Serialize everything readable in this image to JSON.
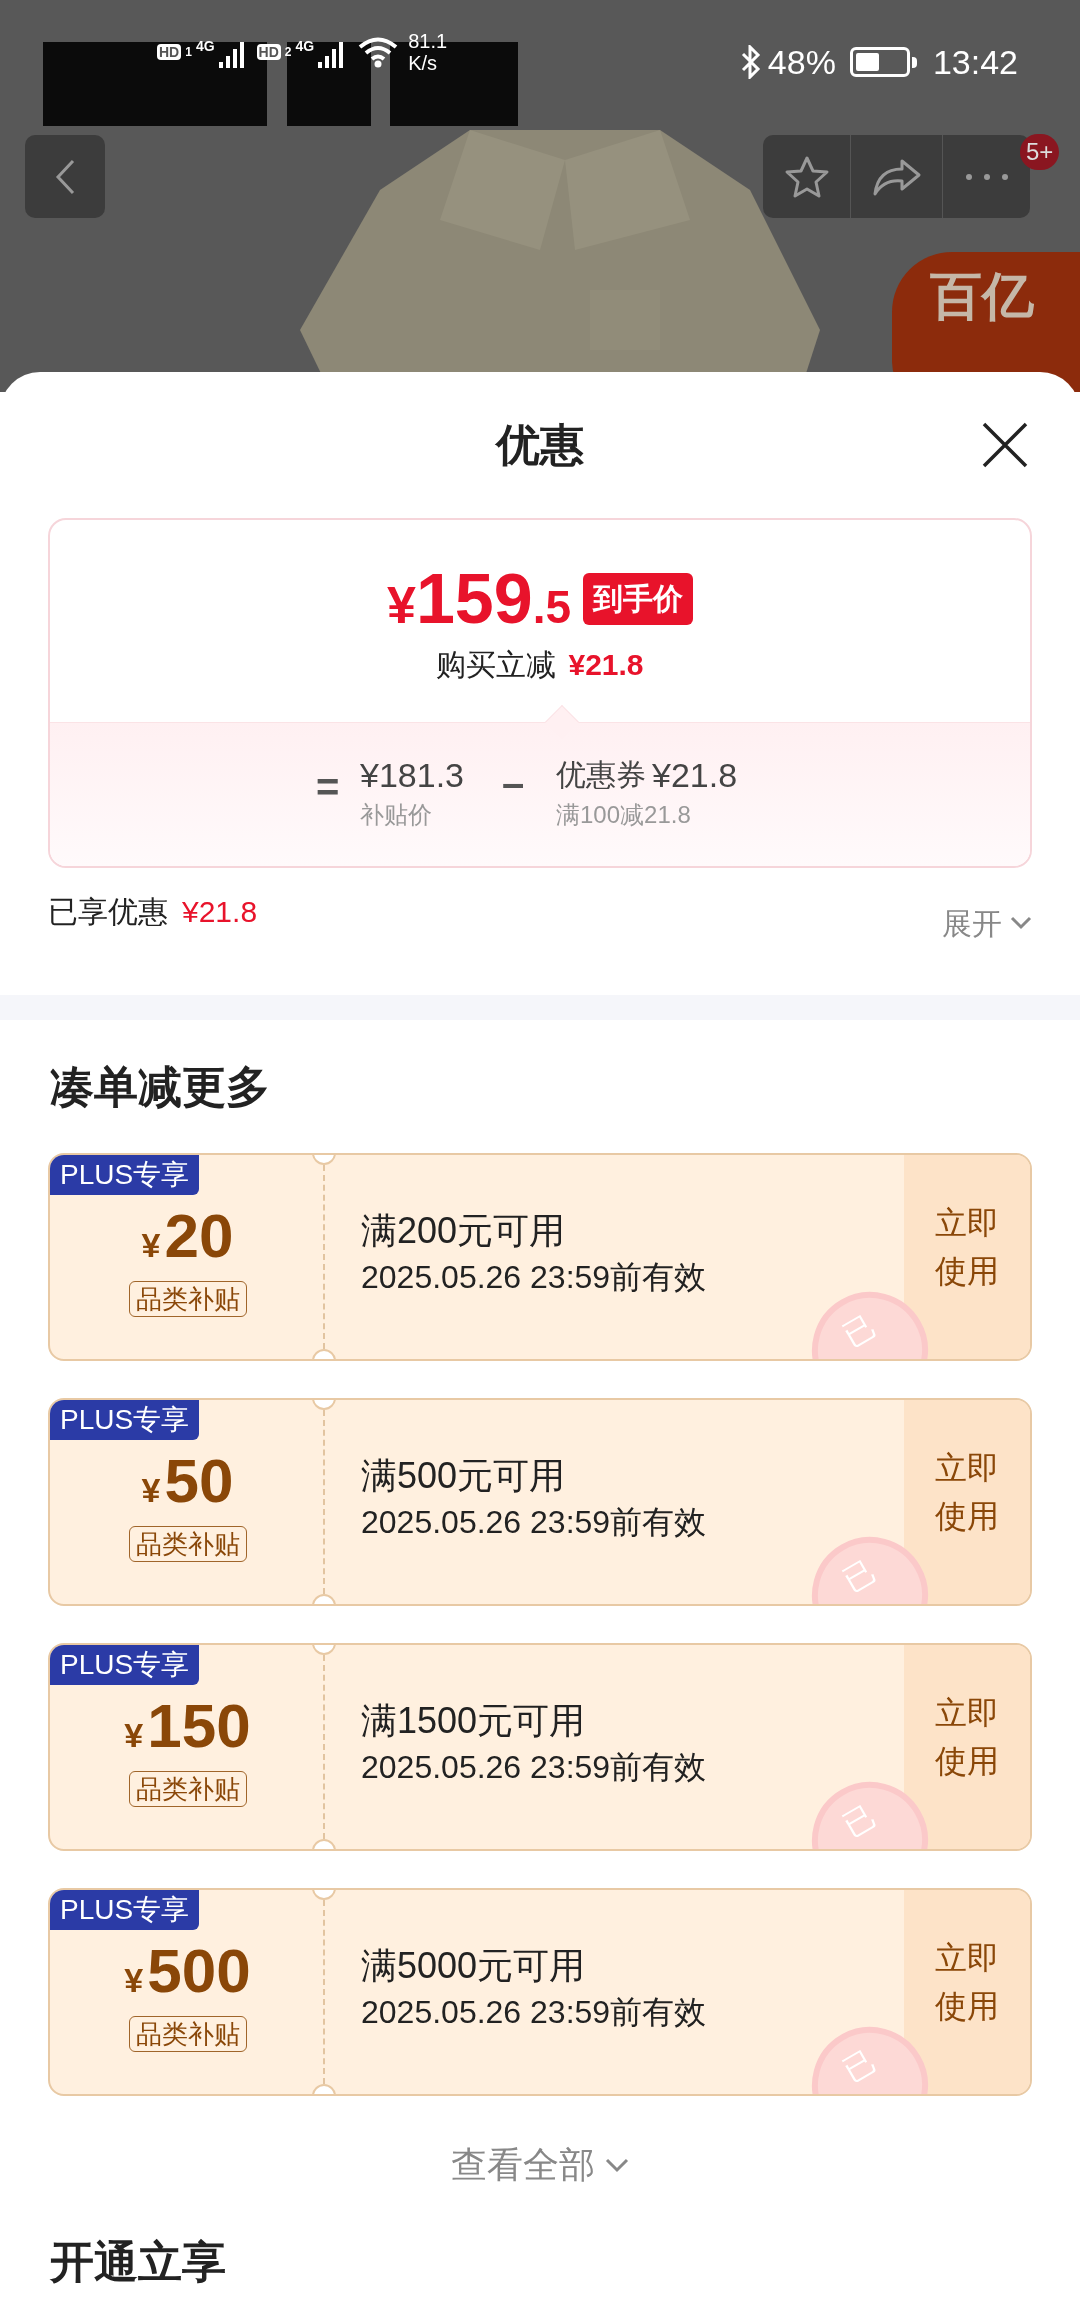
{
  "status_bar": {
    "sims": [
      {
        "label": "HD",
        "index": "1",
        "network": "4G"
      },
      {
        "label": "HD",
        "index": "2",
        "network": "4G"
      }
    ],
    "network_speed": "81.1",
    "speed_unit": "K/s",
    "battery": "48%",
    "time": "13:42"
  },
  "nav": {
    "badge": "5+",
    "promo_badge": "百亿"
  },
  "sheet": {
    "title": "优惠"
  },
  "price_card": {
    "currency": "¥",
    "integer": "159",
    "decimal": ".5",
    "tag": "到手价",
    "saving_label": "购买立减",
    "saving": "¥21.8",
    "equals": "=",
    "base_price": "¥181.3",
    "base_label": "补贴价",
    "minus": "–",
    "coupon_label": "优惠券",
    "coupon_amount": "¥21.8",
    "coupon_rule": "满100减21.8"
  },
  "enjoyed": {
    "label": "已享优惠",
    "amount": "¥21.8",
    "expand": "展开"
  },
  "section_title": "凑单减更多",
  "coupons": [
    {
      "tag": "PLUS专享",
      "currency": "¥",
      "amount": "20",
      "category": "品类补贴",
      "condition": "满200元可用",
      "expiry": "2025.05.26 23:59前有效",
      "action": "立即使用",
      "stamp": "已"
    },
    {
      "tag": "PLUS专享",
      "currency": "¥",
      "amount": "50",
      "category": "品类补贴",
      "condition": "满500元可用",
      "expiry": "2025.05.26 23:59前有效",
      "action": "立即使用",
      "stamp": "已"
    },
    {
      "tag": "PLUS专享",
      "currency": "¥",
      "amount": "150",
      "category": "品类补贴",
      "condition": "满1500元可用",
      "expiry": "2025.05.26 23:59前有效",
      "action": "立即使用",
      "stamp": "已"
    },
    {
      "tag": "PLUS专享",
      "currency": "¥",
      "amount": "500",
      "category": "品类补贴",
      "condition": "满5000元可用",
      "expiry": "2025.05.26 23:59前有效",
      "action": "立即使用",
      "stamp": "已"
    }
  ],
  "view_all": "查看全部",
  "next_section_title": "开通立享"
}
